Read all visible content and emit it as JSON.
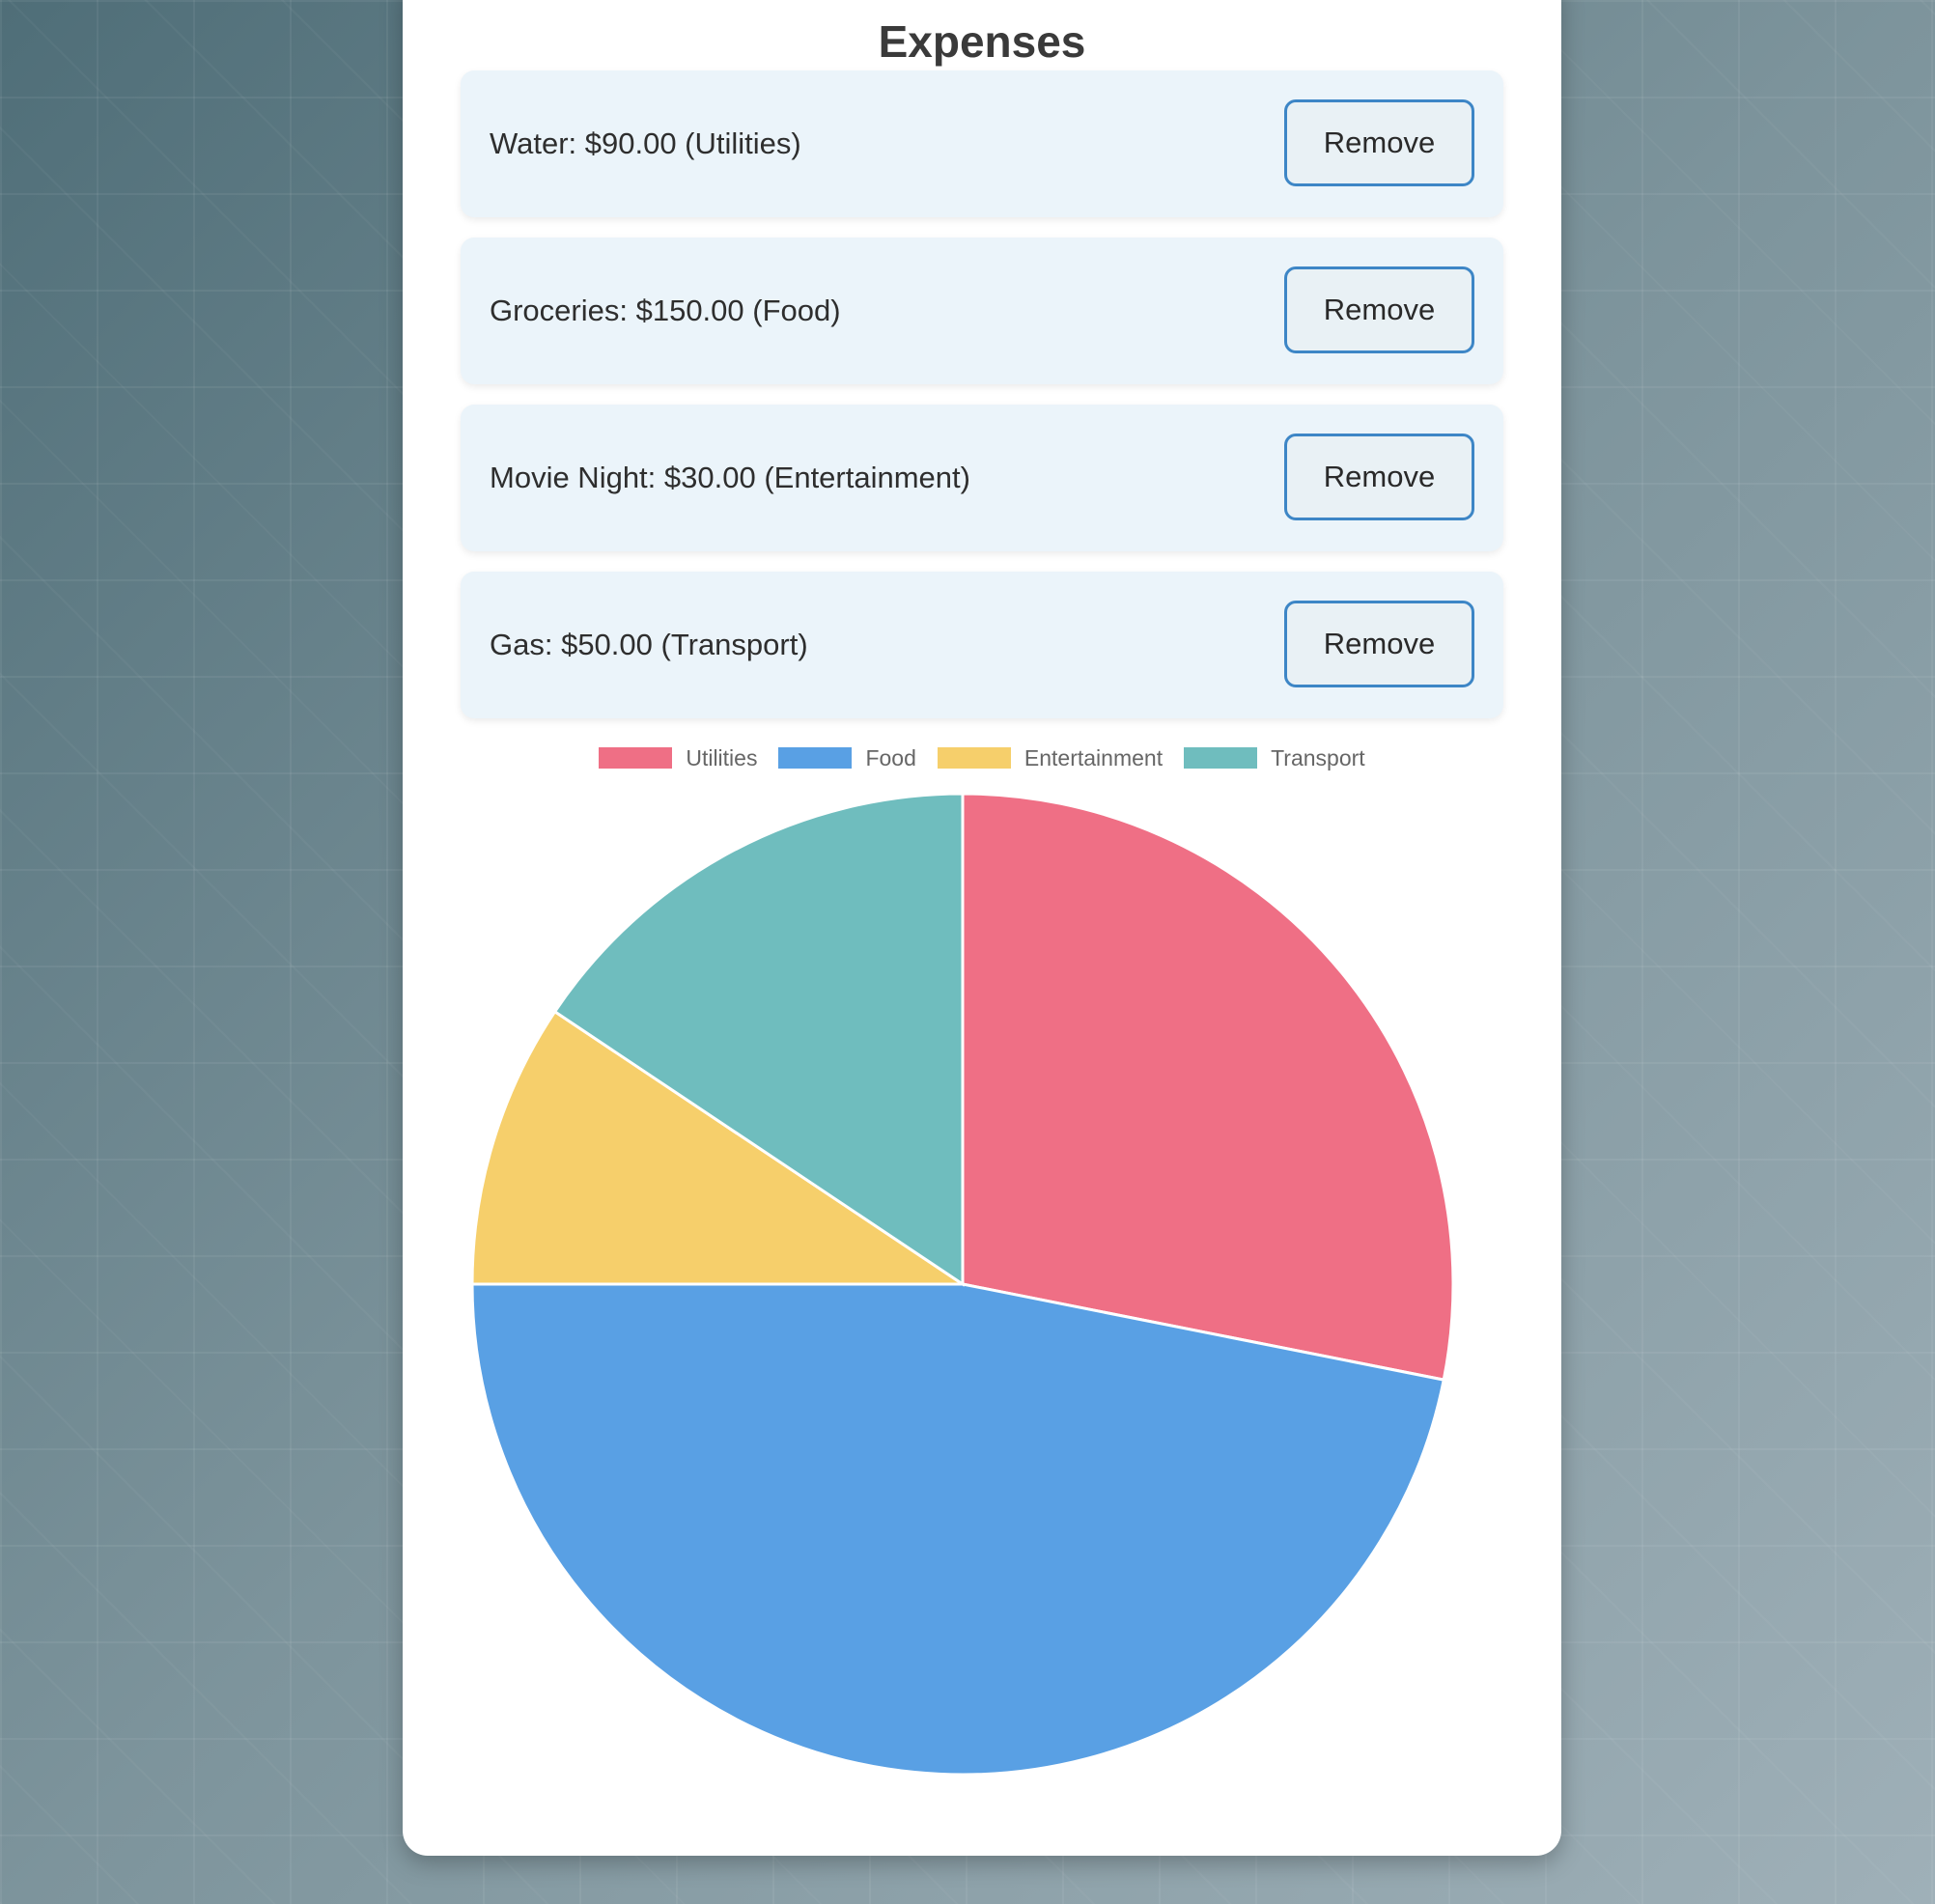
{
  "title": "Expenses",
  "expenses": [
    {
      "text": "Water: $90.00 (Utilities)",
      "remove_label": "Remove"
    },
    {
      "text": "Groceries: $150.00 (Food)",
      "remove_label": "Remove"
    },
    {
      "text": "Movie Night: $30.00 (Entertainment)",
      "remove_label": "Remove"
    },
    {
      "text": "Gas: $50.00 (Transport)",
      "remove_label": "Remove"
    }
  ],
  "chart_data": {
    "type": "pie",
    "categories": [
      "Utilities",
      "Food",
      "Entertainment",
      "Transport"
    ],
    "values": [
      90,
      150,
      30,
      50
    ],
    "colors": [
      "#ef6f85",
      "#59a0e4",
      "#f6cf6b",
      "#6fbdbe"
    ],
    "legend": "top"
  }
}
